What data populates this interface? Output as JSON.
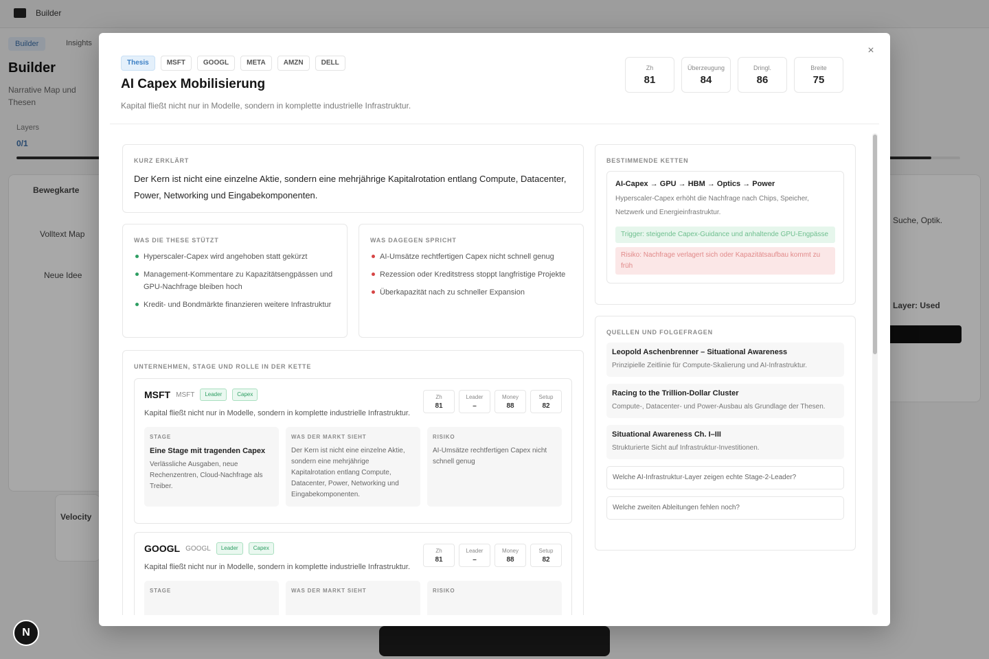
{
  "background": {
    "brand": "Builder",
    "subnav_active": "Builder",
    "subnav_other": "Insights",
    "page_title": "Builder",
    "page_desc": "Narrative Map und Thesen",
    "stat_label": "Layers",
    "stat_value": "0/1",
    "card1_text": "Bewegkarte",
    "card2_text": "Volltext Map",
    "card3_text": "Neue Idee",
    "right_text1": "Suche, Optik.",
    "right_text2": "Layer: Used",
    "left_card_title": "Velocity",
    "fab_label": "N"
  },
  "modal": {
    "close_label": "×",
    "tags": [
      "Thesis",
      "MSFT",
      "GOOGL",
      "META",
      "AMZN",
      "DELL"
    ],
    "title": "AI Capex Mobilisierung",
    "subtitle": "Kapital fließt nicht nur in Modelle, sondern in komplette industrielle Infrastruktur.",
    "metrics": [
      {
        "label": "Zh",
        "value": "81"
      },
      {
        "label": "Überzeugung",
        "value": "84"
      },
      {
        "label": "Dringl.",
        "value": "86"
      },
      {
        "label": "Breite",
        "value": "75"
      }
    ],
    "intro": {
      "label": "Kurz erklärt",
      "text": "Der Kern ist nicht eine einzelne Aktie, sondern eine mehrjährige Kapitalrotation entlang Compute, Datacenter, Power, Networking und Eingabekomponenten."
    },
    "pros": {
      "label": "Was die These stützt",
      "items": [
        "Hyperscaler-Capex wird angehoben statt gekürzt",
        "Management-Kommentare zu Kapazitätsengpässen und GPU-Nachfrage bleiben hoch",
        "Kredit- und Bondmärkte finanzieren weitere Infrastruktur"
      ]
    },
    "cons": {
      "label": "Was dagegen spricht",
      "items": [
        "AI-Umsätze rechtfertigen Capex nicht schnell genug",
        "Rezession oder Kreditstress stoppt langfristige Projekte",
        "Überkapazität nach zu schneller Expansion"
      ]
    },
    "companies": {
      "label": "Unternehmen, Stage und Rolle in der Kette",
      "list": [
        {
          "name": "MSFT",
          "ticker": "MSFT",
          "badges": [
            "Leader",
            "Capex"
          ],
          "desc": "Kapital fließt nicht nur in Modelle, sondern in komplette industrielle Infrastruktur.",
          "metrics": [
            {
              "label": "Zh",
              "value": "81"
            },
            {
              "label": "Leader",
              "value": "–"
            },
            {
              "label": "Money",
              "value": "88"
            },
            {
              "label": "Setup",
              "value": "82"
            }
          ],
          "cols": [
            {
              "label": "Stage",
              "head": "Eine Stage mit tragenden Capex",
              "text": "Verlässliche Ausgaben, neue Rechenzentren, Cloud-Nachfrage als Treiber."
            },
            {
              "label": "Was der Markt sieht",
              "head": "",
              "text": "Der Kern ist nicht eine einzelne Aktie, sondern eine mehrjährige Kapitalrotation entlang Compute, Datacenter, Power, Networking und Eingabekomponenten."
            },
            {
              "label": "Risiko",
              "head": "",
              "text": "AI-Umsätze rechtfertigen Capex nicht schnell genug"
            }
          ]
        },
        {
          "name": "GOOGL",
          "ticker": "GOOGL",
          "badges": [
            "Leader",
            "Capex"
          ],
          "desc": "Kapital fließt nicht nur in Modelle, sondern in komplette industrielle Infrastruktur.",
          "metrics": [
            {
              "label": "Zh",
              "value": "81"
            },
            {
              "label": "Leader",
              "value": "–"
            },
            {
              "label": "Money",
              "value": "88"
            },
            {
              "label": "Setup",
              "value": "82"
            }
          ],
          "cols": [
            {
              "label": "Stage",
              "head": "",
              "text": ""
            },
            {
              "label": "Was der Markt sieht",
              "head": "",
              "text": ""
            },
            {
              "label": "Risiko",
              "head": "",
              "text": ""
            }
          ]
        }
      ]
    },
    "dominant": {
      "label": "Bestimmende Ketten",
      "title": "AI-Capex → GPU → HBM → Optics → Power",
      "text": "Hyperscaler-Capex erhöht die Nachfrage nach Chips, Speicher, Netzwerk und Energieinfrastruktur.",
      "green": "Trigger: steigende Capex-Guidance und anhaltende GPU-Engpässe",
      "red": "Risiko: Nachfrage verlagert sich oder Kapazitätsaufbau kommt zu früh"
    },
    "sources": {
      "label": "Quellen und Folgefragen",
      "items": [
        {
          "title": "Leopold Aschenbrenner – Situational Awareness",
          "sub": "Prinzipielle Zeitlinie für Compute-Skalierung und AI-Infrastruktur."
        },
        {
          "title": "Racing to the Trillion-Dollar Cluster",
          "sub": "Compute-, Datacenter- und Power-Ausbau als Grundlage der Thesen."
        },
        {
          "title": "Situational Awareness Ch. I–III",
          "sub": "Strukturierte Sicht auf Infrastruktur-Investitionen."
        }
      ],
      "questions": [
        "Welche AI-Infrastruktur-Layer zeigen echte Stage-2-Leader?",
        "Welche zweiten Ableitungen fehlen noch?"
      ]
    }
  }
}
